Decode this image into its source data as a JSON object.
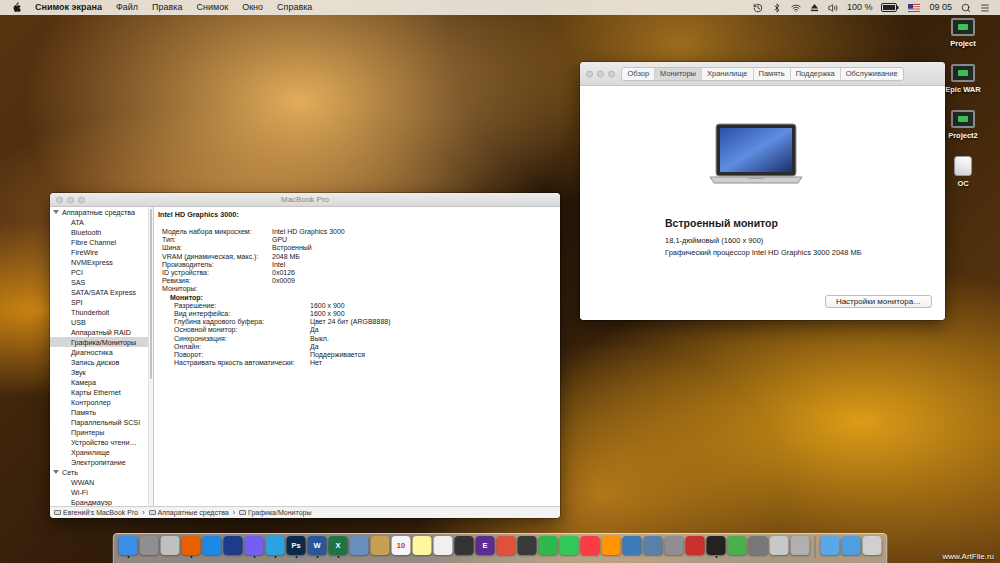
{
  "menu_bar": {
    "app": "Снимок экрана",
    "items": [
      "Файл",
      "Правка",
      "Снимок",
      "Окно",
      "Справка"
    ],
    "battery": {
      "reading": "100 %",
      "level": 1
    },
    "time": "09 05"
  },
  "desktop_icons": [
    {
      "label": "Project",
      "kind": "screen"
    },
    {
      "label": "Epic WAR",
      "kind": "screen"
    },
    {
      "label": "Project2",
      "kind": "screen"
    },
    {
      "label": "OC",
      "kind": "drive"
    }
  ],
  "system_info": {
    "title": "MacBook Pro",
    "sidebar": {
      "groups": [
        {
          "label": "Аппаратные средства",
          "expanded": true,
          "items": [
            {
              "label": "ATA",
              "selected": false
            },
            {
              "label": "Bluetooth",
              "selected": false
            },
            {
              "label": "Fibre Channel",
              "selected": false
            },
            {
              "label": "FireWire",
              "selected": false
            },
            {
              "label": "NVMExpress",
              "selected": false
            },
            {
              "label": "PCI",
              "selected": false
            },
            {
              "label": "SAS",
              "selected": false
            },
            {
              "label": "SATA/SATA Express",
              "selected": false
            },
            {
              "label": "SPI",
              "selected": false
            },
            {
              "label": "Thunderbolt",
              "selected": false
            },
            {
              "label": "USB",
              "selected": false
            },
            {
              "label": "Аппаратный RAID",
              "selected": false
            },
            {
              "label": "Графика/Мониторы",
              "selected": true
            },
            {
              "label": "Диагностика",
              "selected": false
            },
            {
              "label": "Запись дисков",
              "selected": false
            },
            {
              "label": "Звук",
              "selected": false
            },
            {
              "label": "Камера",
              "selected": false
            },
            {
              "label": "Карты Ethernet",
              "selected": false
            },
            {
              "label": "Контроллер",
              "selected": false
            },
            {
              "label": "Память",
              "selected": false
            },
            {
              "label": "Параллельный SCSI",
              "selected": false
            },
            {
              "label": "Принтеры",
              "selected": false
            },
            {
              "label": "Устройство чтени…",
              "selected": false
            },
            {
              "label": "Хранилище",
              "selected": false
            },
            {
              "label": "Электропитание",
              "selected": false
            }
          ]
        },
        {
          "label": "Сеть",
          "expanded": true,
          "items": [
            {
              "label": "WWAN",
              "selected": false
            },
            {
              "label": "Wi-Fi",
              "selected": false
            },
            {
              "label": "Брандмауэр",
              "selected": false
            }
          ]
        }
      ]
    },
    "detail": {
      "heading": "Intel HD Graphics 3000:",
      "rows": [
        {
          "kind": "field",
          "key": "Модель набора микросхем:",
          "value": "Intel HD Graphics 3000"
        },
        {
          "kind": "field",
          "key": "Тип:",
          "value": "GPU"
        },
        {
          "kind": "field",
          "key": "Шина:",
          "value": "Встроенный"
        },
        {
          "kind": "field",
          "key": "VRAM (динамическая, макс.):",
          "value": "2048 МБ"
        },
        {
          "kind": "field",
          "key": "Производитель:",
          "value": "Intel"
        },
        {
          "kind": "field",
          "key": "ID устройства:",
          "value": "0x0126"
        },
        {
          "kind": "field",
          "key": "Ревизия:",
          "value": "0x0009"
        },
        {
          "kind": "group",
          "key": "Мониторы:",
          "value": ""
        },
        {
          "kind": "subgroup",
          "key": "Монитор:",
          "value": ""
        },
        {
          "kind": "subfield",
          "key": "Разрешение:",
          "value": "1600 x 900"
        },
        {
          "kind": "subfield",
          "key": "Вид интерфейса:",
          "value": "1600 x 900"
        },
        {
          "kind": "subfield",
          "key": "Глубина кадрового буфера:",
          "value": "Цвет 24 бит (ARGB8888)"
        },
        {
          "kind": "subfield",
          "key": "Основной монитор:",
          "value": "Да"
        },
        {
          "kind": "subfield",
          "key": "Синхронизация:",
          "value": "Выкл."
        },
        {
          "kind": "subfield",
          "key": "Онлайн:",
          "value": "Да"
        },
        {
          "kind": "subfield",
          "key": "Поворот:",
          "value": "Поддерживается"
        },
        {
          "kind": "subfield",
          "key": "Настраивать яркость автоматически:",
          "value": "Нет"
        }
      ]
    },
    "path_bar": {
      "separator": "›",
      "crumbs": [
        "Евгений's MacBook Pro",
        "Аппаратные средства",
        "Графика/Мониторы"
      ]
    }
  },
  "about_window": {
    "tabs": [
      {
        "label": "Обзор",
        "selected": false
      },
      {
        "label": "Мониторы",
        "selected": true
      },
      {
        "label": "Хранилище",
        "selected": false
      },
      {
        "label": "Память",
        "selected": false
      },
      {
        "label": "Поддержка",
        "selected": false
      },
      {
        "label": "Обслуживание",
        "selected": false
      }
    ],
    "display": {
      "title": "Встроенный монитор",
      "size": "18,1-дюймовый (1600 x 900)",
      "gpu": "Графический процессор Intel HD Graphics 3000 2048 МБ"
    },
    "button": "Настройки монитора…"
  },
  "dock": {
    "apps": [
      {
        "color": "#3a8ee6",
        "label": "",
        "running": true
      },
      {
        "color": "#8e8e93",
        "label": "",
        "running": false
      },
      {
        "color": "#c0c0c0",
        "label": "",
        "running": false
      },
      {
        "color": "#e66000",
        "label": "",
        "running": true
      },
      {
        "color": "#1e88e5",
        "label": "",
        "running": false
      },
      {
        "color": "#1e3a8a",
        "label": "",
        "running": false
      },
      {
        "color": "#7360f2",
        "label": "",
        "running": true
      },
      {
        "color": "#2aa3e0",
        "label": "",
        "running": true
      },
      {
        "color": "#0b2a4a",
        "label": "Ps",
        "running": true
      },
      {
        "color": "#2b579a",
        "label": "W",
        "running": true
      },
      {
        "color": "#217346",
        "label": "X",
        "running": true
      },
      {
        "color": "#6a8fbf",
        "label": "",
        "running": false
      },
      {
        "color": "#c8a052",
        "label": "",
        "running": false
      },
      {
        "color": "#f5f5f5",
        "label": "10",
        "running": false
      },
      {
        "color": "#fff6a0",
        "label": "",
        "running": false
      },
      {
        "color": "#f0f0f0",
        "label": "",
        "running": false
      },
      {
        "color": "#333333",
        "label": "",
        "running": false
      },
      {
        "color": "#5b2d8e",
        "label": "E",
        "running": false
      },
      {
        "color": "#e0503c",
        "label": "",
        "running": false
      },
      {
        "color": "#3a3a3a",
        "label": "",
        "running": false
      },
      {
        "color": "#2fb84d",
        "label": "",
        "running": false
      },
      {
        "color": "#34c759",
        "label": "",
        "running": false
      },
      {
        "color": "#fc3c44",
        "label": "",
        "running": false
      },
      {
        "color": "#ff9500",
        "label": "",
        "running": false
      },
      {
        "color": "#3d7ab8",
        "label": "",
        "running": false
      },
      {
        "color": "#5a7fa8",
        "label": "",
        "running": false
      },
      {
        "color": "#8e8e93",
        "label": "",
        "running": false
      },
      {
        "color": "#c9302c",
        "label": "",
        "running": false
      },
      {
        "color": "#222222",
        "label": "",
        "running": true
      },
      {
        "color": "#4bb04b",
        "label": "",
        "running": false
      },
      {
        "color": "#777777",
        "label": "",
        "running": false
      },
      {
        "color": "#c8c8c8",
        "label": "",
        "running": false
      },
      {
        "color": "#b0b0b0",
        "label": "",
        "running": false
      }
    ],
    "stacks": [
      {
        "color": "#5aa9e6"
      },
      {
        "color": "#4f9fe0"
      },
      {
        "color": "#d0d0d0"
      }
    ]
  },
  "watermark": "www.ArtFile.ru"
}
